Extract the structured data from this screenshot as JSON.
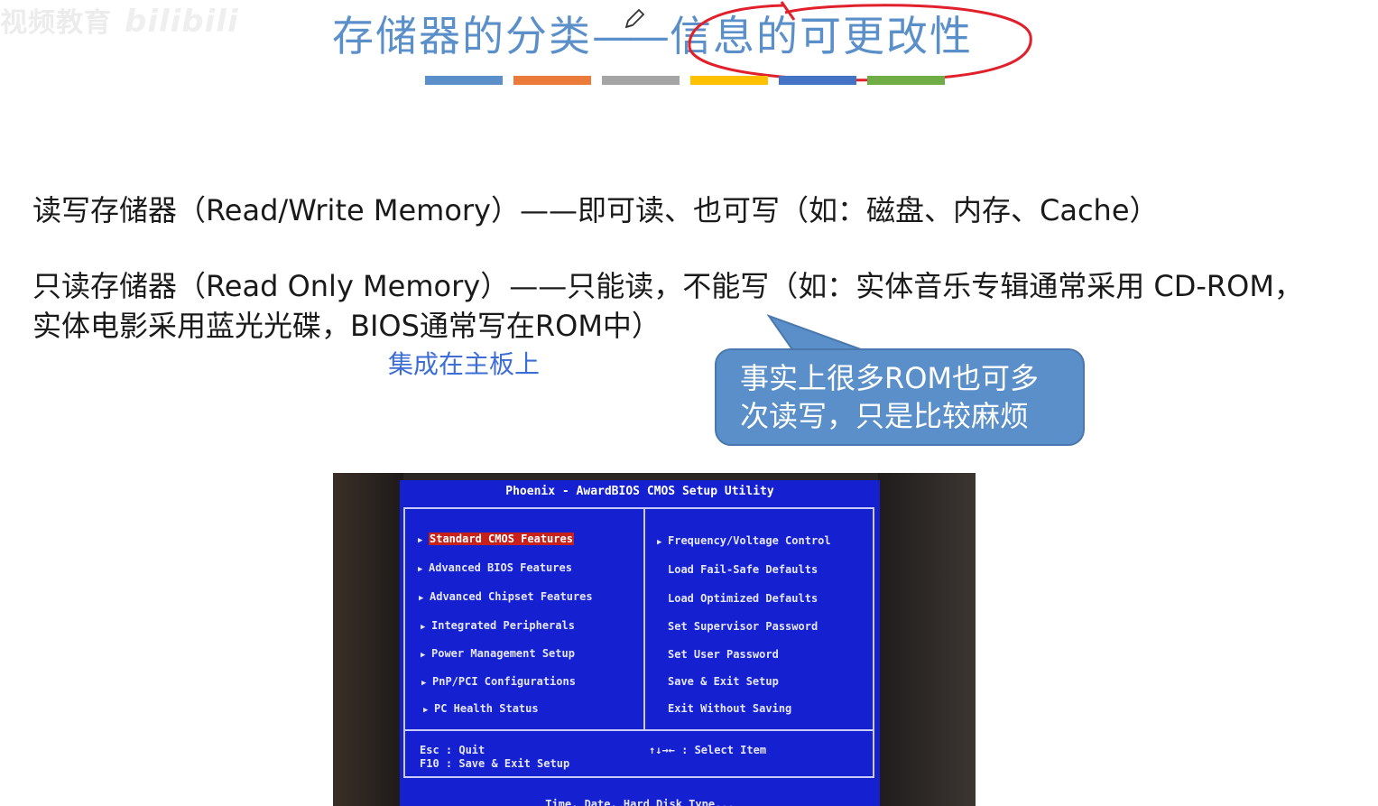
{
  "watermark": {
    "text": "视频教育",
    "brand": "bilibili"
  },
  "title": {
    "main": "存储器的分类",
    "sep": "——",
    "sub": "信息的可更改性"
  },
  "colors": {
    "title": "#5b8fc9",
    "bars": [
      "#5b8fc9",
      "#ea7b3a",
      "#a5a5a5",
      "#ffc000",
      "#4472c4",
      "#70ad47"
    ],
    "annotation": "#e0202a",
    "callout": "#5b8fc9",
    "note": "#3c6ed6"
  },
  "lines": {
    "rw": "读写存储器（Read/Write Memory）——即可读、也可写（如：磁盘、内存、Cache）",
    "rom_1": "只读存储器（Read Only Memory）——只能读，不能写（如：实体音乐专辑通常采用 CD-ROM，",
    "rom_2": "实体电影采用蓝光光碟，BIOS通常写在ROM中）"
  },
  "note": "集成在主板上",
  "callout": {
    "line1": "事实上很多ROM也可多",
    "line2": "次读写，只是比较麻烦"
  },
  "bios": {
    "header": "Phoenix - AwardBIOS CMOS Setup Utility",
    "left_menu": [
      "Standard CMOS Features",
      "Advanced BIOS Features",
      "Advanced Chipset Features",
      "Integrated Peripherals",
      "Power Management Setup",
      "PnP/PCI Configurations",
      "PC Health Status"
    ],
    "right_menu": [
      "Frequency/Voltage Control",
      "Load Fail-Safe Defaults",
      "Load Optimized Defaults",
      "Set Supervisor Password",
      "Set User Password",
      "Save & Exit Setup",
      "Exit Without Saving"
    ],
    "footer_left_1": "Esc : Quit",
    "footer_left_2": "F10 : Save & Exit Setup",
    "footer_right": "↑↓→←   : Select Item",
    "status": "Time, Date, Hard Disk Type..."
  }
}
